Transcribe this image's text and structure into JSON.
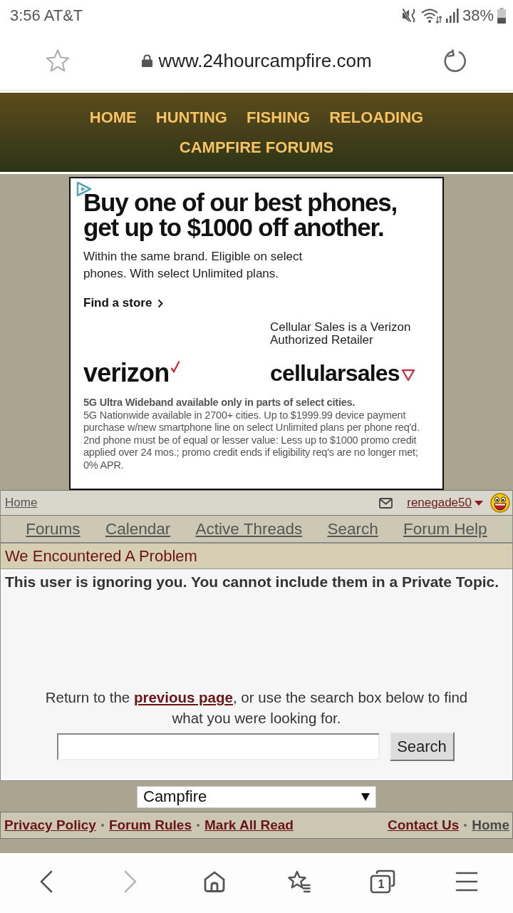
{
  "status_bar": {
    "time_carrier": "3:56 AT&T",
    "battery": "38%"
  },
  "address_bar": {
    "url": "www.24hourcampfire.com"
  },
  "site_nav": [
    "HOME",
    "HUNTING",
    "FISHING",
    "RELOADING",
    "CAMPFIRE FORUMS"
  ],
  "ad": {
    "headline": "Buy one of our best phones, get up to $1000 off another.",
    "body": "Within the same brand. Eligible on select phones. With select Unlimited plans.",
    "link": "Find a store",
    "retailer_note": "Cellular Sales is a Verizon Authorized Retailer",
    "brand_logo": "verizon",
    "retailer_logo": "cellularsales",
    "fine_print_heading": "5G Ultra Wideband available only in parts of select cities.",
    "fine_print": "5G Nationwide available in 2700+ cities. Up to $1999.99 device payment purchase w/new smartphone line on select Unlimited plans per phone req'd. 2nd phone must be of equal or lesser value: Less up to $1000 promo credit applied over 24 mos.; promo credit ends if eligibility req's are no longer met; 0% APR."
  },
  "breadcrumb": {
    "home": "Home",
    "username": "renegade50"
  },
  "forum_tabs": [
    "Forums",
    "Calendar",
    "Active Threads",
    "Search",
    "Forum Help"
  ],
  "problem": {
    "title": "We Encountered A Problem",
    "message": "This user is ignoring you. You cannot include them in a Private Topic.",
    "hint_before": "Return to the ",
    "hint_link": "previous page",
    "hint_after": ", or use the search box below to find what you were looking for.",
    "search_button": "Search"
  },
  "forum_select": {
    "value": "Campfire"
  },
  "footer": {
    "left_links": [
      {
        "label": "Privacy Policy",
        "visited": false
      },
      {
        "label": "Forum Rules",
        "visited": false
      },
      {
        "label": "Mark All Read",
        "visited": false
      }
    ],
    "right_links": [
      {
        "label": "Contact Us",
        "visited": false
      },
      {
        "label": "Home",
        "visited": true
      }
    ]
  },
  "bottom_nav": [
    {
      "kind": "back",
      "disabled": false
    },
    {
      "kind": "forward",
      "disabled": true
    },
    {
      "kind": "home",
      "disabled": false
    },
    {
      "kind": "bookmarks",
      "disabled": false
    },
    {
      "kind": "tabs",
      "disabled": false,
      "count": "1"
    },
    {
      "kind": "menu",
      "disabled": false
    }
  ]
}
